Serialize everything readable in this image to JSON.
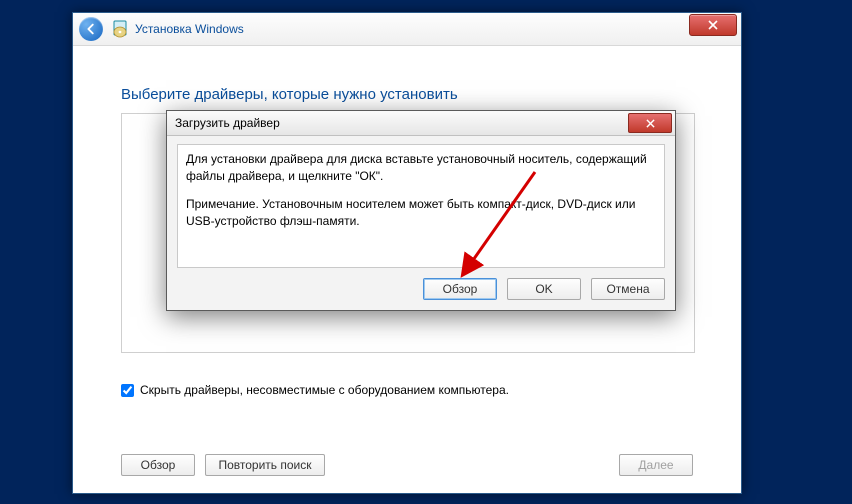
{
  "window": {
    "title": "Установка Windows"
  },
  "page": {
    "heading": "Выберите драйверы, которые нужно установить",
    "hide_incompatible": "Скрыть драйверы, несовместимые с оборудованием компьютера.",
    "hide_incompatible_checked": true
  },
  "buttons": {
    "browse": "Обзор",
    "rescan": "Повторить поиск",
    "next": "Далее"
  },
  "dialog": {
    "title": "Загрузить драйвер",
    "paragraph1": "Для установки драйвера для диска вставьте установочный носитель, содержащий файлы драйвера, и щелкните \"ОК\".",
    "paragraph2": "Примечание. Установочным носителем может быть компакт-диск, DVD-диск или USB-устройство флэш-памяти.",
    "browse": "Обзор",
    "ok": "OK",
    "cancel": "Отмена"
  },
  "colors": {
    "accent": "#0a4e9b",
    "desktop": "#01245b",
    "arrow": "#d40000"
  }
}
